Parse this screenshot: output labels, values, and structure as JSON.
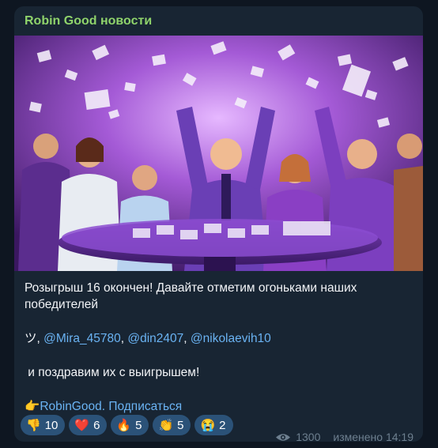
{
  "post": {
    "channel_name": "Robin Good новости",
    "text_line1": "Розыгрыш 16 окончен! Давайте отметим огоньками наших победителей",
    "winners_prefix": "ツ, ",
    "winners": [
      "@Mira_45780",
      "@din2407",
      "@nikolaevih10"
    ],
    "separator": ", ",
    "congrats": " и поздравим их с выигрышем!",
    "signature_emoji": "👉",
    "signature_link": "RobinGood. Подписаться"
  },
  "reactions": [
    {
      "emoji": "👎",
      "count": "10",
      "icon": "thumbs-down-icon"
    },
    {
      "emoji": "❤️",
      "count": "6",
      "icon": "heart-icon"
    },
    {
      "emoji": "🔥",
      "count": "5",
      "icon": "fire-icon"
    },
    {
      "emoji": "👏",
      "count": "5",
      "icon": "clapping-hands-icon"
    },
    {
      "emoji": "😭",
      "count": "2",
      "icon": "crying-face-icon"
    }
  ],
  "meta": {
    "views": "1300",
    "edited_time": "изменено 14:19"
  },
  "colors": {
    "background": "#0e1621",
    "bubble": "#182533",
    "channel_name": "#8fd36b",
    "link": "#6ab3f3",
    "reaction_bg": "#2b5278",
    "meta": "#6d7f8f"
  }
}
